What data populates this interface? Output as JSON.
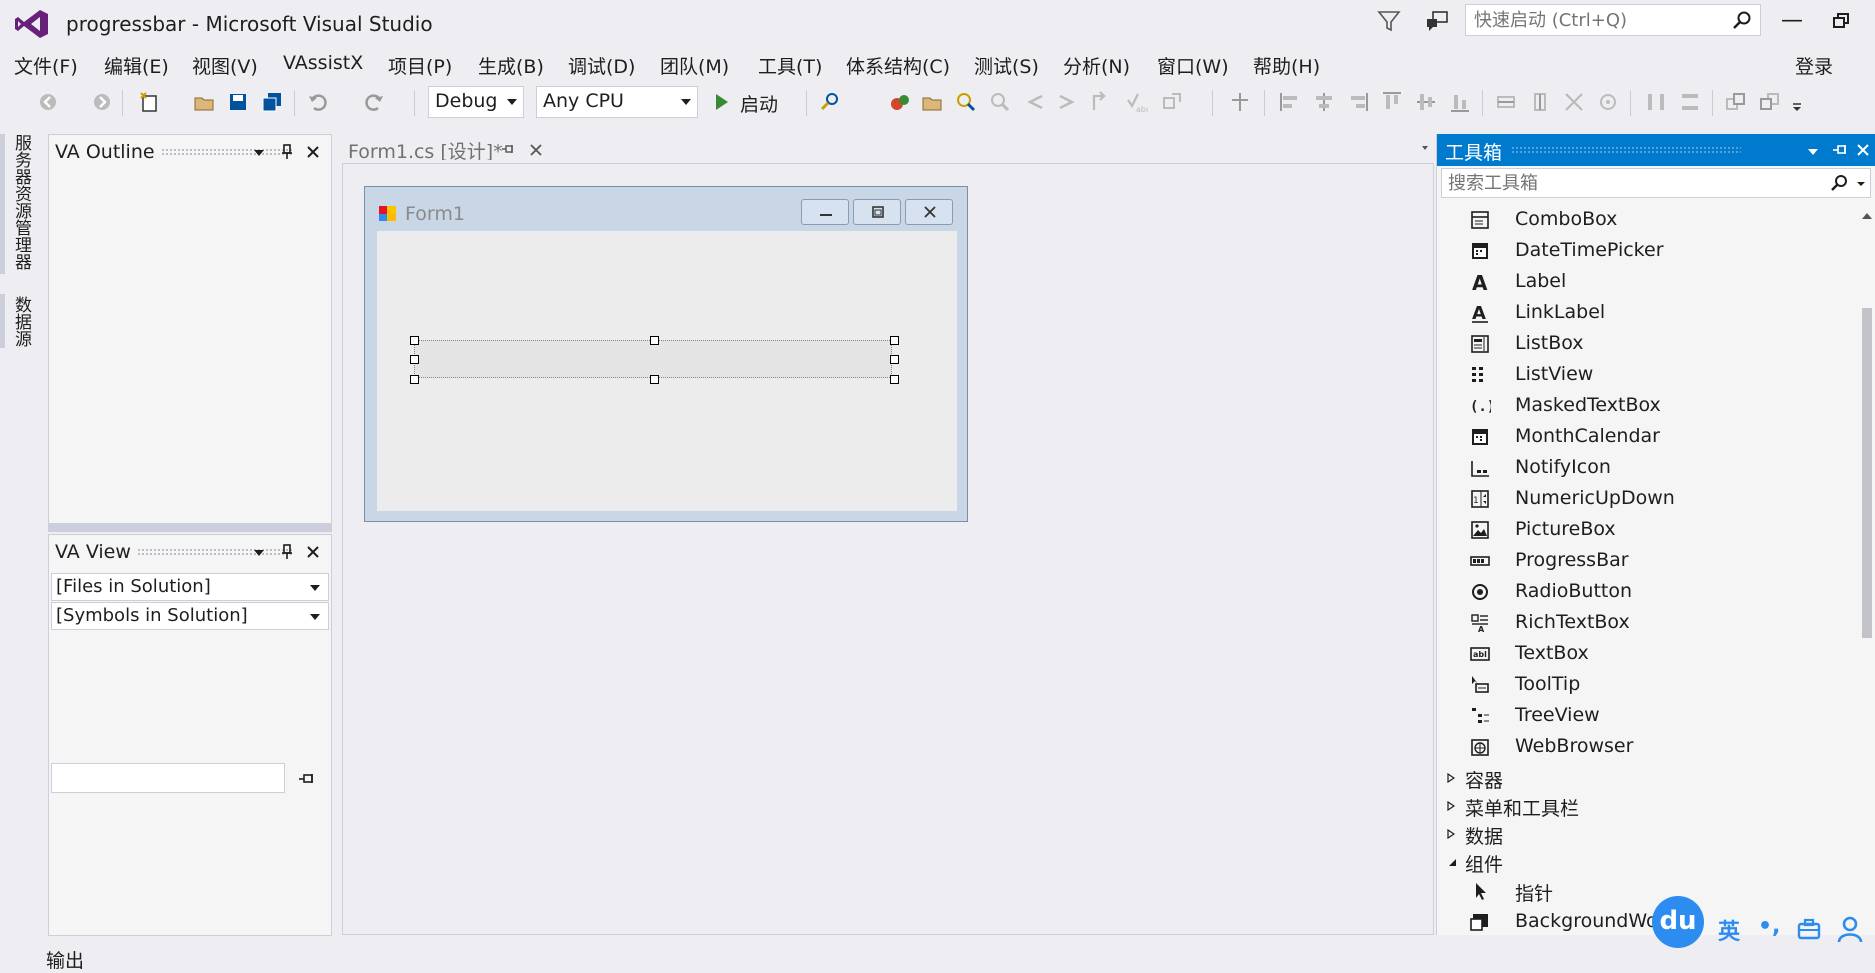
{
  "window": {
    "title": "progressbar - Microsoft Visual Studio",
    "quick_launch_placeholder": "快速启动 (Ctrl+Q)",
    "minimize_glyph": "—"
  },
  "menu": {
    "items": [
      "文件(F)",
      "编辑(E)",
      "视图(V)",
      "VAssistX",
      "项目(P)",
      "生成(B)",
      "调试(D)",
      "团队(M)",
      "工具(T)",
      "体系结构(C)",
      "测试(S)",
      "分析(N)",
      "窗口(W)",
      "帮助(H)"
    ],
    "login": "登录"
  },
  "toolbar": {
    "config": "Debug",
    "platform": "Any CPU",
    "start_label": "启动"
  },
  "side_tabs": {
    "server_explorer": "服务器资源管理器",
    "data_sources": "数据源"
  },
  "va_outline": {
    "title": "VA Outline"
  },
  "va_view": {
    "title": "VA View",
    "files_select": "[Files in Solution]",
    "symbols_select": "[Symbols in Solution]"
  },
  "document": {
    "tab_label": "Form1.cs [设计]*",
    "form_title": "Form1"
  },
  "toolbox": {
    "title": "工具箱",
    "search_placeholder": "搜索工具箱",
    "items": [
      "ComboBox",
      "DateTimePicker",
      "Label",
      "LinkLabel",
      "ListBox",
      "ListView",
      "MaskedTextBox",
      "MonthCalendar",
      "NotifyIcon",
      "NumericUpDown",
      "PictureBox",
      "ProgressBar",
      "RadioButton",
      "RichTextBox",
      "TextBox",
      "ToolTip",
      "TreeView",
      "WebBrowser"
    ],
    "categories": [
      "容器",
      "菜单和工具栏",
      "数据",
      "组件"
    ],
    "component_items": [
      "指针",
      "BackgroundWorker"
    ]
  },
  "status": {
    "output_label": "输出"
  },
  "ime": {
    "badge": "du",
    "lang": "英",
    "punct": "•,"
  },
  "colors": {
    "accent": "#007acc",
    "vs_purple": "#68217a",
    "ime_blue": "#2d8cf0"
  }
}
